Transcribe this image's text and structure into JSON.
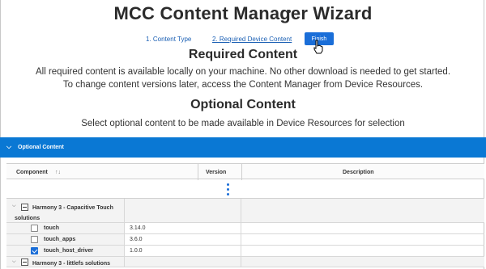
{
  "wizard": {
    "title": "MCC Content Manager Wizard",
    "steps": [
      "1. Content Type",
      "2. Required Device Content"
    ],
    "finish_label": "Finish"
  },
  "required": {
    "title": "Required Content",
    "line1": "All required content is available locally on your machine. No other download is needed to get started.",
    "line2": "To change content versions later, access the Content Manager from Device Resources."
  },
  "optional": {
    "title": "Optional Content",
    "line1": "Select optional content to be made available in Device Resources for selection",
    "panel_label": "Optional Content"
  },
  "table": {
    "headers": {
      "component": "Component",
      "version": "Version",
      "description": "Description"
    },
    "sort_glyph": "↑↓",
    "groups": [
      {
        "name": "Harmony 3 - Capacitive Touch solutions",
        "items": [
          {
            "name": "touch",
            "version": "3.14.0",
            "checked": false
          },
          {
            "name": "touch_apps",
            "version": "3.6.0",
            "checked": false
          },
          {
            "name": "touch_host_driver",
            "version": "1.0.0",
            "checked": true
          }
        ]
      },
      {
        "name": "Harmony 3 - littlefs solutions",
        "items": []
      }
    ]
  },
  "colors": {
    "accent": "#1a6ed8",
    "panel": "#0a78d4"
  }
}
